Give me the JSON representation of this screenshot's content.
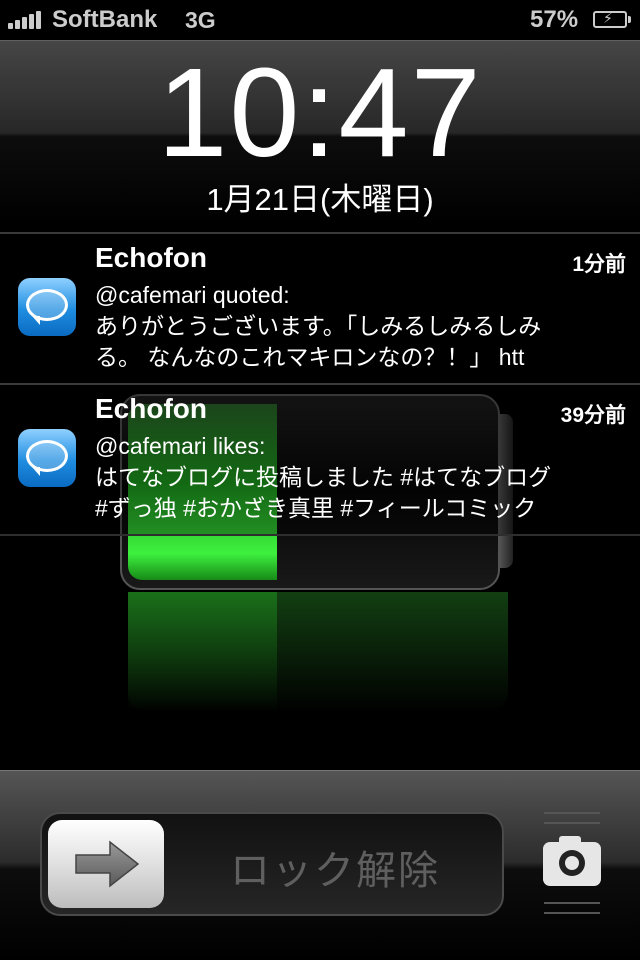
{
  "status_bar": {
    "carrier": "SoftBank",
    "network": "3G",
    "battery_percent": "57%",
    "signal_icon": "signal-bars-icon",
    "battery_icon": "battery-charging-icon"
  },
  "lock_screen": {
    "time": "10:47",
    "date": "1月21日(木曜日)",
    "charging_level": 0.57
  },
  "notifications": [
    {
      "app": "Echofon",
      "time_ago": "1分前",
      "icon": "echofon-app-icon",
      "lines": [
        "@cafemari quoted:",
        "ありがとうございます。「しみるしみるしみ",
        "る。 なんなのこれマキロンなの？！」 htt"
      ]
    },
    {
      "app": "Echofon",
      "time_ago": "39分前",
      "icon": "echofon-app-icon",
      "lines": [
        "@cafemari likes:",
        "はてなブログに投稿しました #はてなブログ",
        "#ずっ独 #おかざき真里 #フィールコミック"
      ]
    }
  ],
  "unlock": {
    "label": "ロック解除",
    "knob_icon": "arrow-right-icon",
    "camera_icon": "camera-icon"
  },
  "colors": {
    "battery_green": "#3ef03e",
    "background": "#000000"
  }
}
